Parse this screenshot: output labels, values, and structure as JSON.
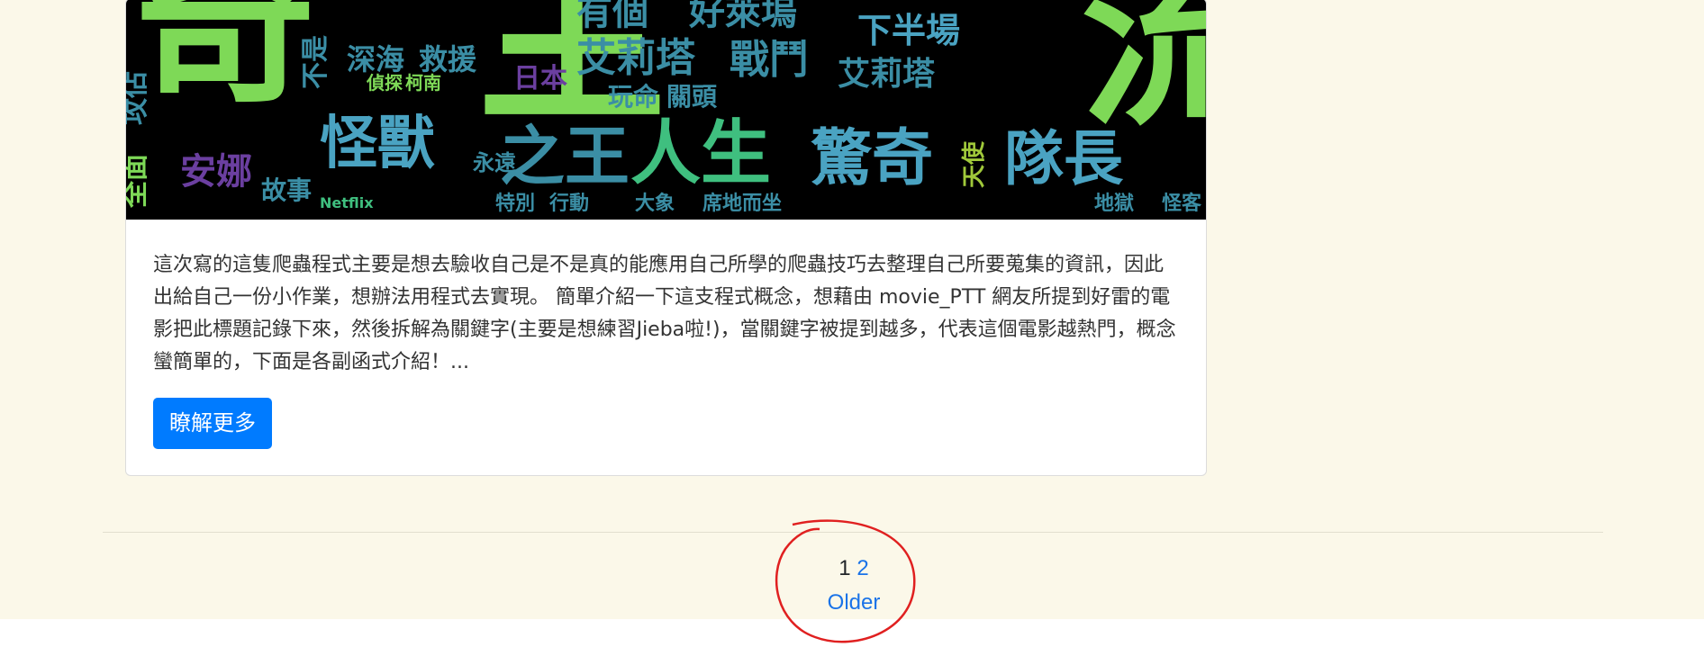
{
  "post": {
    "image_alt_icon": "word-cloud-image",
    "excerpt": "這次寫的這隻爬蟲程式主要是想去驗收自己是不是真的能應用自己所學的爬蟲技巧去整理自己所要蒐集的資訊，因此出給自己一份小作業，想辦法用程式去實現。 簡單介紹一下這支程式概念，想藉由 movie_PTT 網友所提到好雷的電影把此標題記錄下來，然後拆解為關鍵字(主要是想練習Jieba啦!)，當關鍵字被提到越多，代表這個電影越熱門，概念蠻簡單的，下面是各副函式介紹！...",
    "read_more_label": "瞭解更多"
  },
  "wordcloud": {
    "words": [
      {
        "text": "奇",
        "color": "#7ed957"
      },
      {
        "text": "主",
        "color": "#7ed957"
      },
      {
        "text": "流",
        "color": "#7ed957"
      },
      {
        "text": "有個",
        "color": "#3b8ea5"
      },
      {
        "text": "好萊塢",
        "color": "#3b8ea5"
      },
      {
        "text": "下半場",
        "color": "#4aa3c2"
      },
      {
        "text": "深海",
        "color": "#3b8ea5"
      },
      {
        "text": "救援",
        "color": "#3b8ea5"
      },
      {
        "text": "艾莉塔",
        "color": "#3b8ea5"
      },
      {
        "text": "戰鬥",
        "color": "#3b8ea5"
      },
      {
        "text": "艾莉塔",
        "color": "#3b8ea5"
      },
      {
        "text": "日本",
        "color": "#6b3fa0"
      },
      {
        "text": "玩命",
        "color": "#3b8ea5"
      },
      {
        "text": "關頭",
        "color": "#3b8ea5"
      },
      {
        "text": "全面",
        "color": "#7ed957"
      },
      {
        "text": "攻佔",
        "color": "#3b8ea5"
      },
      {
        "text": "怪獸",
        "color": "#4aa3c2"
      },
      {
        "text": "之王",
        "color": "#3b8ea5"
      },
      {
        "text": "人生",
        "color": "#3fbf7f"
      },
      {
        "text": "驚奇",
        "color": "#4aa3c2"
      },
      {
        "text": "隊長",
        "color": "#4aa3c2"
      },
      {
        "text": "安娜",
        "color": "#6b3fa0"
      },
      {
        "text": "故事",
        "color": "#3b8ea5"
      },
      {
        "text": "永遠",
        "color": "#3b8ea5"
      },
      {
        "text": "Netflix",
        "color": "#3fbf7f"
      },
      {
        "text": "特別",
        "color": "#3b8ea5"
      },
      {
        "text": "行動",
        "color": "#3b8ea5"
      },
      {
        "text": "大象",
        "color": "#3b8ea5"
      },
      {
        "text": "席地而坐",
        "color": "#3b8ea5"
      },
      {
        "text": "天使",
        "color": "#a0c93a"
      },
      {
        "text": "地獄",
        "color": "#3b8ea5"
      },
      {
        "text": "怪客",
        "color": "#3b8ea5"
      },
      {
        "text": "偵探",
        "color": "#7ed957"
      },
      {
        "text": "柯南",
        "color": "#7ed957"
      },
      {
        "text": "不是",
        "color": "#3b8ea5"
      }
    ]
  },
  "pagination": {
    "current_page": "1",
    "page_2_label": "2",
    "older_label": "Older"
  },
  "annotation": {
    "color": "#e02020"
  }
}
